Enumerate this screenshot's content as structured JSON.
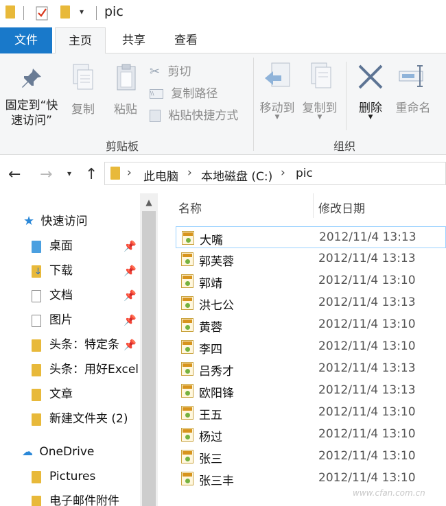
{
  "window": {
    "title": "pic"
  },
  "tabs": {
    "file": "文件",
    "home": "主页",
    "share": "共享",
    "view": "查看"
  },
  "ribbon": {
    "pin": "固定到\"快\n速访问\"",
    "pin_line1": "固定到“快",
    "pin_line2": "速访问”",
    "copy": "复制",
    "paste": "粘贴",
    "cut": "剪切",
    "copy_path": "复制路径",
    "paste_shortcut": "粘贴快捷方式",
    "clipboard_group": "剪贴板",
    "move_to": "移动到",
    "copy_to": "复制到",
    "delete": "删除",
    "rename": "重命名",
    "organize_group": "组织"
  },
  "address": {
    "crumbs": [
      "此电脑",
      "本地磁盘 (C:)",
      "pic"
    ]
  },
  "navpane": {
    "quick_access": "快速访问",
    "items": [
      "桌面",
      "下载",
      "文档",
      "图片",
      "头条：特定条",
      "头条：用好Excel",
      "文章",
      "新建文件夹 (2)"
    ],
    "onedrive": "OneDrive",
    "onedrive_items": [
      "Pictures",
      "电子邮件附件"
    ]
  },
  "filelist": {
    "col_name": "名称",
    "col_date": "修改日期",
    "rows": [
      {
        "name": "大嘴",
        "date": "2012/11/4 13:13"
      },
      {
        "name": "郭芙蓉",
        "date": "2012/11/4 13:13"
      },
      {
        "name": "郭靖",
        "date": "2012/11/4 13:10"
      },
      {
        "name": "洪七公",
        "date": "2012/11/4 13:13"
      },
      {
        "name": "黄蓉",
        "date": "2012/11/4 13:10"
      },
      {
        "name": "李四",
        "date": "2012/11/4 13:10"
      },
      {
        "name": "吕秀才",
        "date": "2012/11/4 13:13"
      },
      {
        "name": "欧阳锋",
        "date": "2012/11/4 13:13"
      },
      {
        "name": "王五",
        "date": "2012/11/4 13:10"
      },
      {
        "name": "杨过",
        "date": "2012/11/4 13:10"
      },
      {
        "name": "张三",
        "date": "2012/11/4 13:10"
      },
      {
        "name": "张三丰",
        "date": "2012/11/4 13:10"
      }
    ]
  },
  "watermark": "www.cfan.com.cn"
}
